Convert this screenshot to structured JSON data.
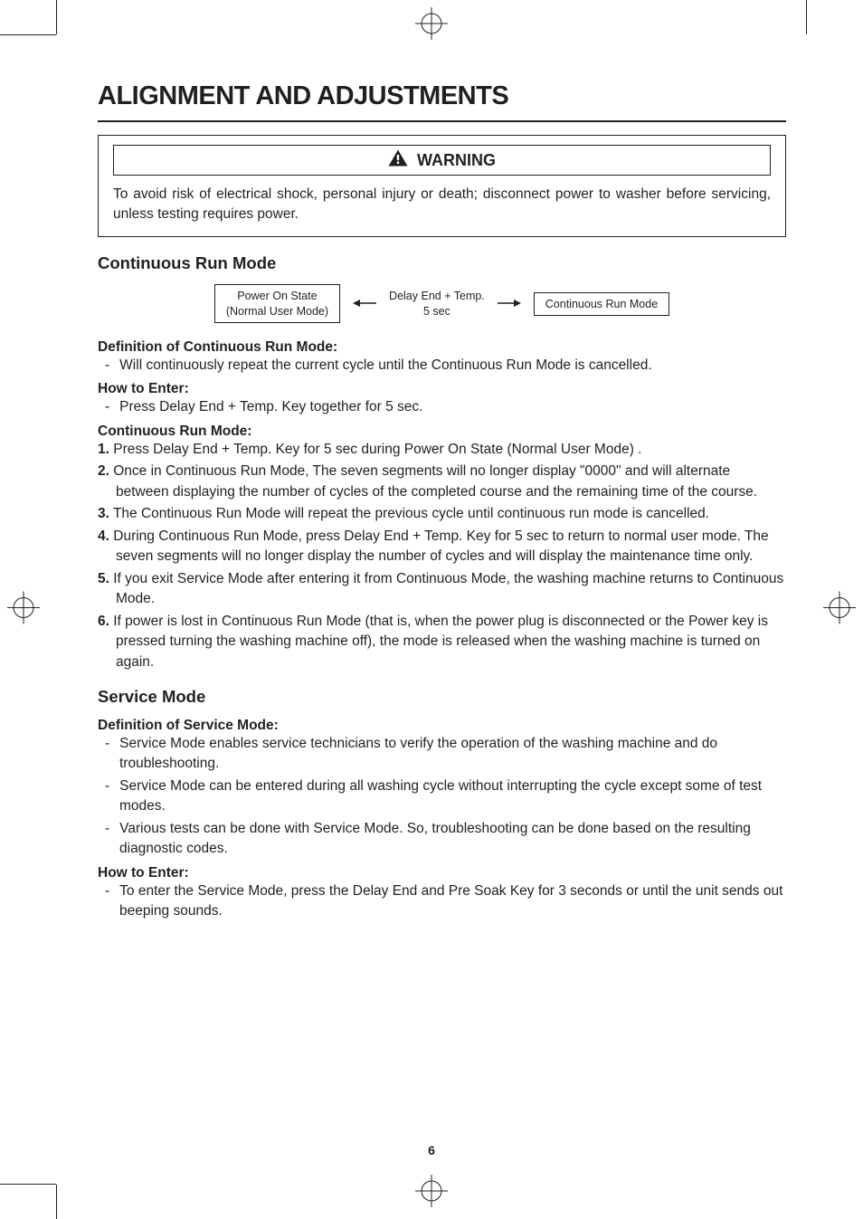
{
  "title": "ALIGNMENT AND ADJUSTMENTS",
  "warning": {
    "header": "WARNING",
    "body": "To avoid risk of electrical shock, personal injury or death; disconnect power to washer before servicing, unless testing requires power."
  },
  "continuous": {
    "heading": "Continuous Run Mode",
    "flow": {
      "box1_line1": "Power On State",
      "box1_line2": "(Normal User Mode)",
      "mid_line1": "Delay End + Temp.",
      "mid_line2": "5 sec",
      "box2": "Continuous Run Mode"
    },
    "def_head": "Definition of Continuous Run Mode:",
    "def_item": "Will continuously repeat the current cycle until the Continuous Run Mode is cancelled.",
    "enter_head": "How to Enter:",
    "enter_item": "Press Delay End + Temp. Key together for 5 sec.",
    "mode_head": "Continuous Run Mode:",
    "steps": [
      "Press Delay End + Temp. Key for 5 sec during Power On State (Normal User Mode) .",
      "Once in Continuous Run Mode, The seven segments will no longer display \"0000\" and will alternate between displaying the number of cycles of the completed course and the remaining time of the course.",
      "The Continuous Run Mode will repeat the previous cycle until continuous run mode is cancelled.",
      "During Continuous Run Mode, press Delay End + Temp. Key for 5 sec to return to normal user mode. The seven segments will no longer display the number of cycles and will display the maintenance time only.",
      "If you exit Service Mode after entering it from Continuous Mode, the washing machine returns to Continuous Mode.",
      "If power is lost in Continuous Run Mode (that is, when the power plug is disconnected or the Power key is pressed turning the washing machine off), the mode is released when the washing machine is turned on again."
    ]
  },
  "service": {
    "heading": "Service Mode",
    "def_head": "Definition of Service Mode:",
    "def_items": [
      "Service Mode enables service technicians to verify the operation of the washing machine and do troubleshooting.",
      "Service Mode can be entered during all washing cycle without interrupting the cycle except some of test modes.",
      "Various tests can be done with Service Mode. So, troubleshooting can be done based on the resulting diagnostic codes."
    ],
    "enter_head": "How to Enter:",
    "enter_item": "To enter the Service Mode, press the Delay End and Pre Soak Key for 3 seconds or until the unit sends out beeping sounds."
  },
  "page_number": "6"
}
